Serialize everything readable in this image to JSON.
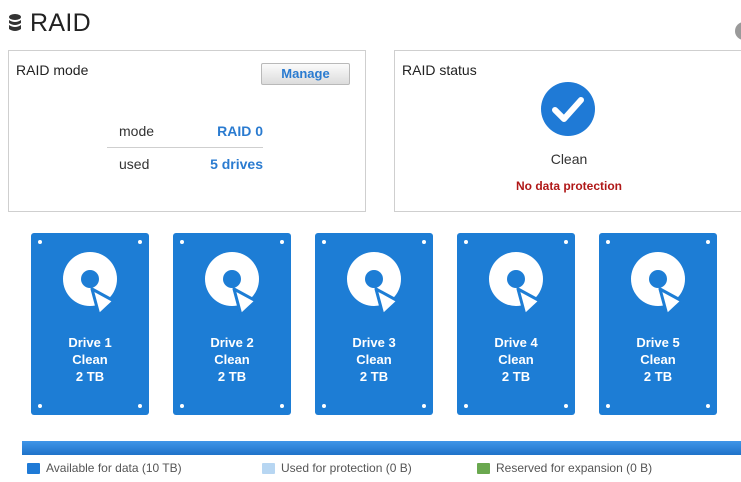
{
  "header": {
    "title": "RAID",
    "help_glyph": "?"
  },
  "mode_panel": {
    "title": "RAID mode",
    "manage_label": "Manage",
    "rows": [
      {
        "label": "mode",
        "value": "RAID 0"
      },
      {
        "label": "used",
        "value": "5 drives"
      }
    ]
  },
  "status_panel": {
    "title": "RAID status",
    "icon": "checkmark-icon",
    "status": "Clean",
    "warning": "No data protection"
  },
  "drives": [
    {
      "name": "Drive 1",
      "status": "Clean",
      "size": "2 TB"
    },
    {
      "name": "Drive 2",
      "status": "Clean",
      "size": "2 TB"
    },
    {
      "name": "Drive 3",
      "status": "Clean",
      "size": "2 TB"
    },
    {
      "name": "Drive 4",
      "status": "Clean",
      "size": "2 TB"
    },
    {
      "name": "Drive 5",
      "status": "Clean",
      "size": "2 TB"
    }
  ],
  "legend": [
    {
      "label": "Available for data (10 TB)",
      "color": "#1f7ad6"
    },
    {
      "label": "Used for protection (0 B)",
      "color": "#b7d6f2"
    },
    {
      "label": "Reserved for expansion (0 B)",
      "color": "#6aa84f"
    }
  ],
  "colors": {
    "accent": "#1d7dd5",
    "warning": "#b01818"
  }
}
